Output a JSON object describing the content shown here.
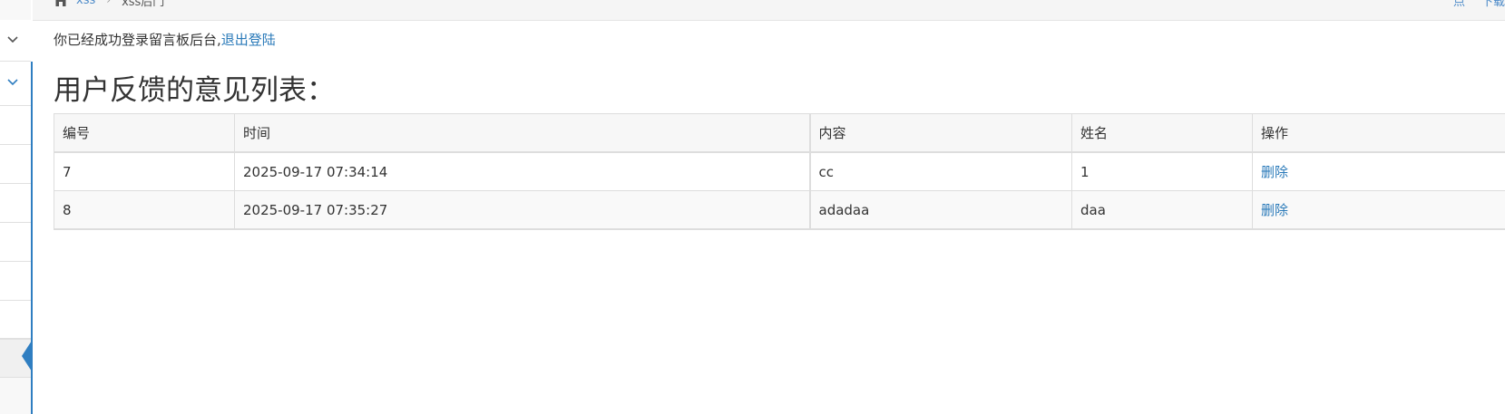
{
  "breadcrumb": {
    "home_icon": "home-icon",
    "items": [
      "xss",
      "xss后门"
    ]
  },
  "topright": {
    "items": [
      "点",
      "下载"
    ]
  },
  "sidebar": {
    "chevron_icon": "chevron-down-icon",
    "accent_color": "#2f7ec1"
  },
  "message": {
    "text": "你已经成功登录留言板后台,",
    "logout_label": "退出登陆"
  },
  "page_title": "用户反馈的意见列表：",
  "table": {
    "headers": [
      "编号",
      "时间",
      "内容",
      "姓名",
      "操作"
    ],
    "rows": [
      {
        "id": "7",
        "time": "2025-09-17 07:34:14",
        "content": "cc",
        "name": "1",
        "action": "删除"
      },
      {
        "id": "8",
        "time": "2025-09-17 07:35:27",
        "content": "adadaa",
        "name": "daa",
        "action": "删除"
      }
    ]
  },
  "colors": {
    "link": "#2a7ab9",
    "accent": "#2f7ec1"
  }
}
